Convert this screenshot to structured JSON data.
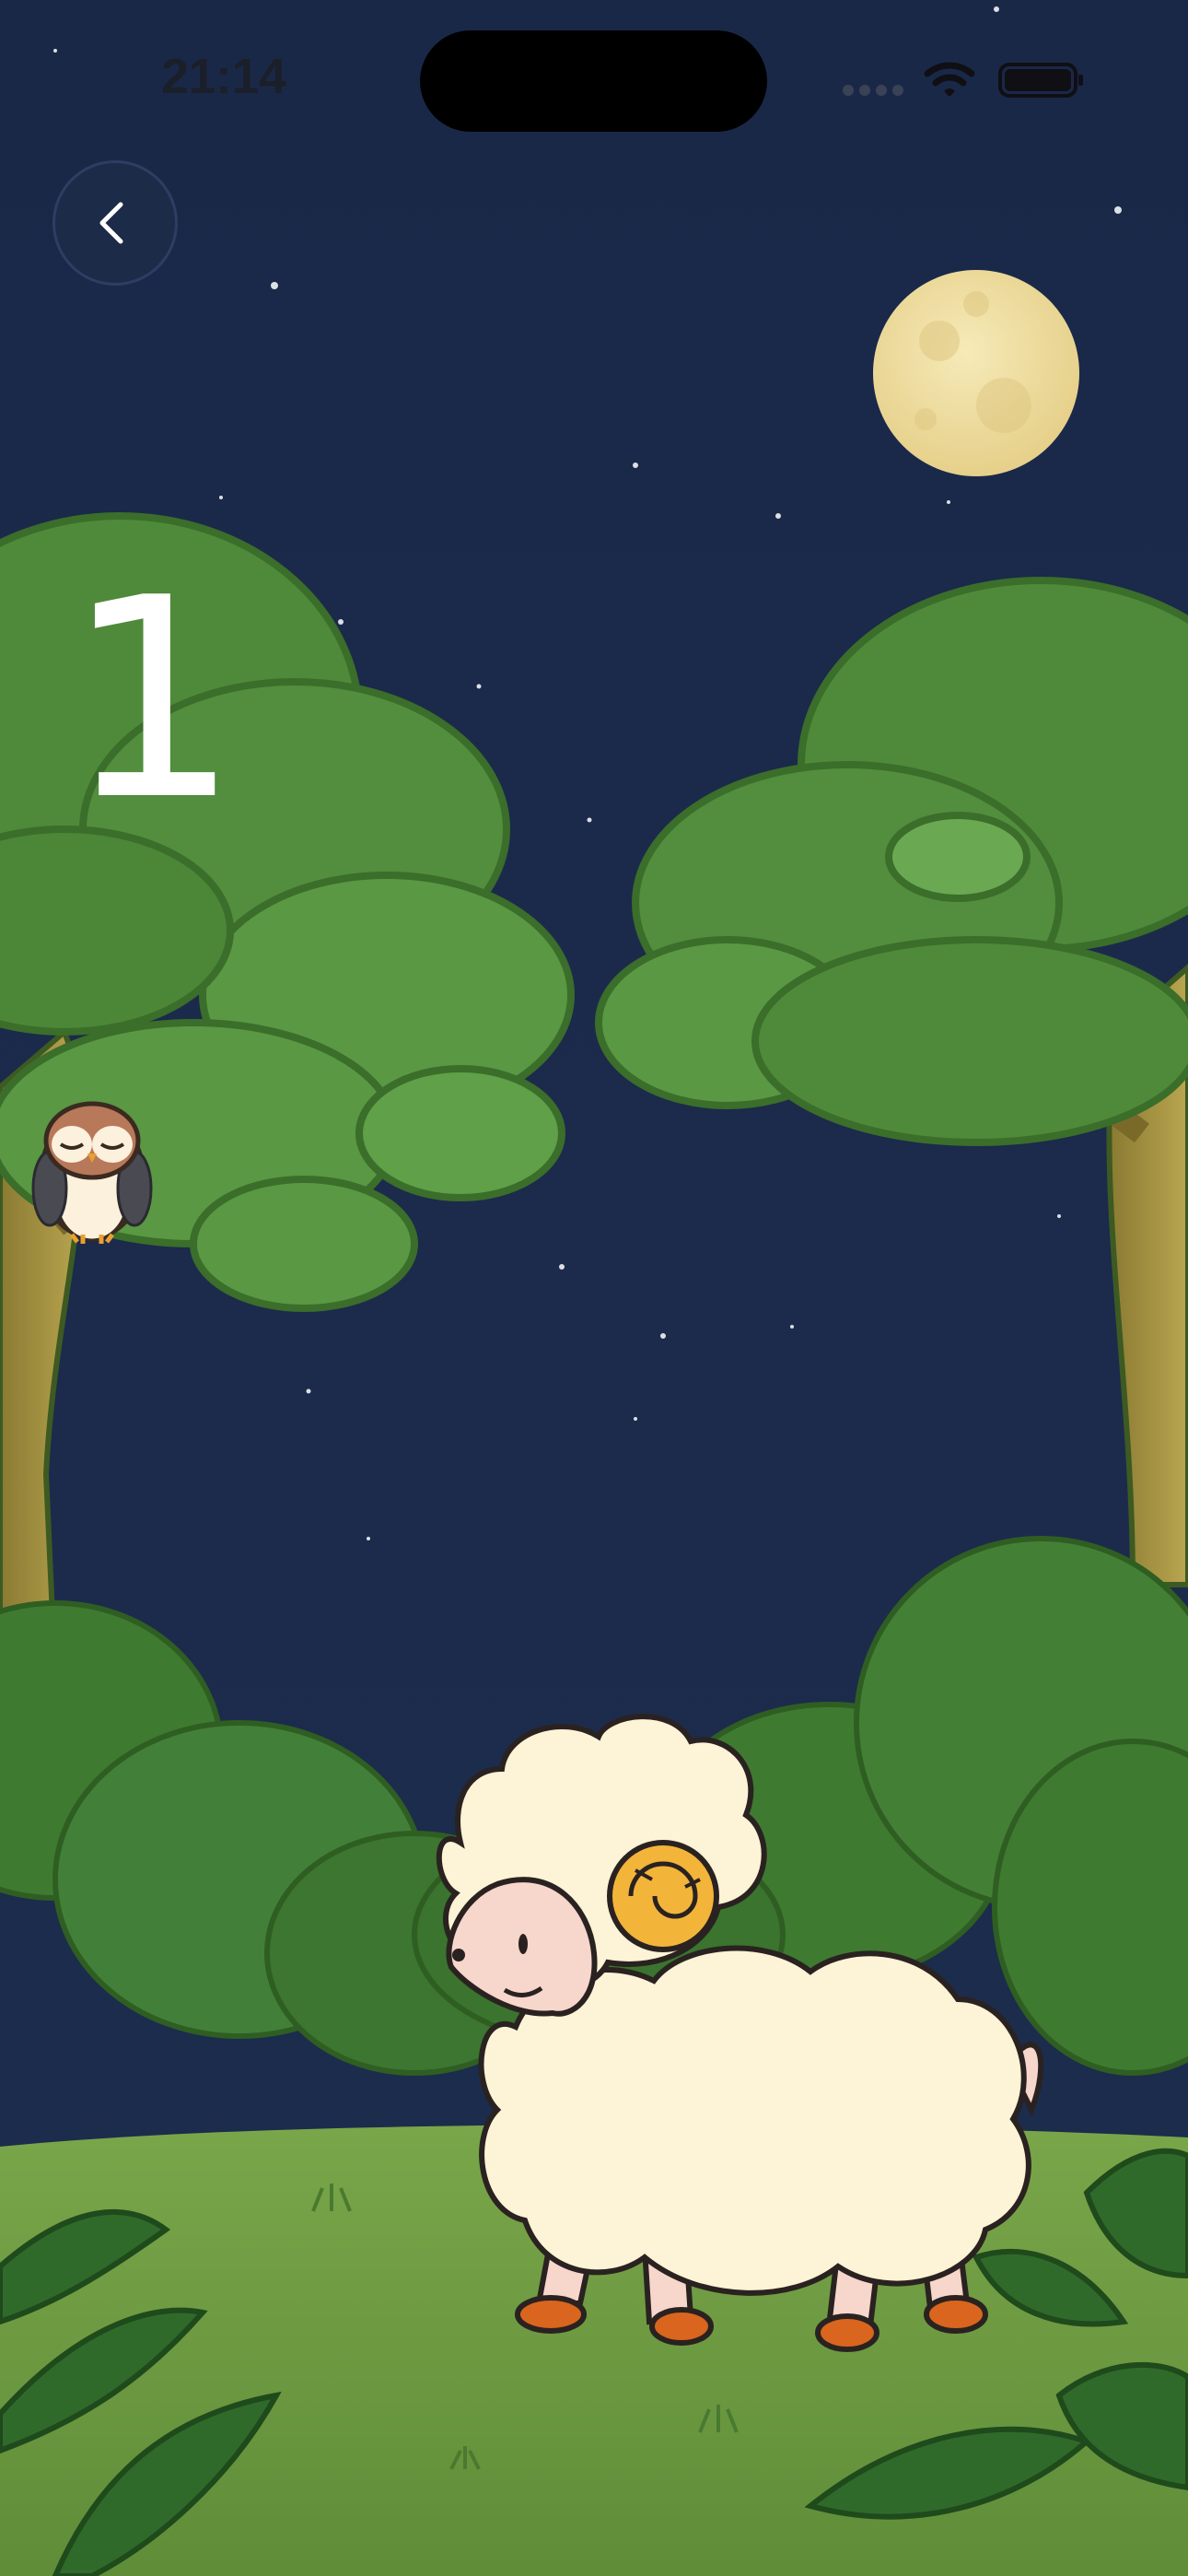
{
  "status_bar": {
    "time": "21:14"
  },
  "navigation": {
    "back_icon": "chevron-left-icon"
  },
  "counter": {
    "value": "1"
  },
  "scene": {
    "sky_color": "#1b2a4a",
    "moon_color": "#f1e3a6",
    "foliage_color": "#4f8a3a",
    "sheep_wool_color": "#fdf3d6",
    "horn_color": "#f2b53a"
  }
}
